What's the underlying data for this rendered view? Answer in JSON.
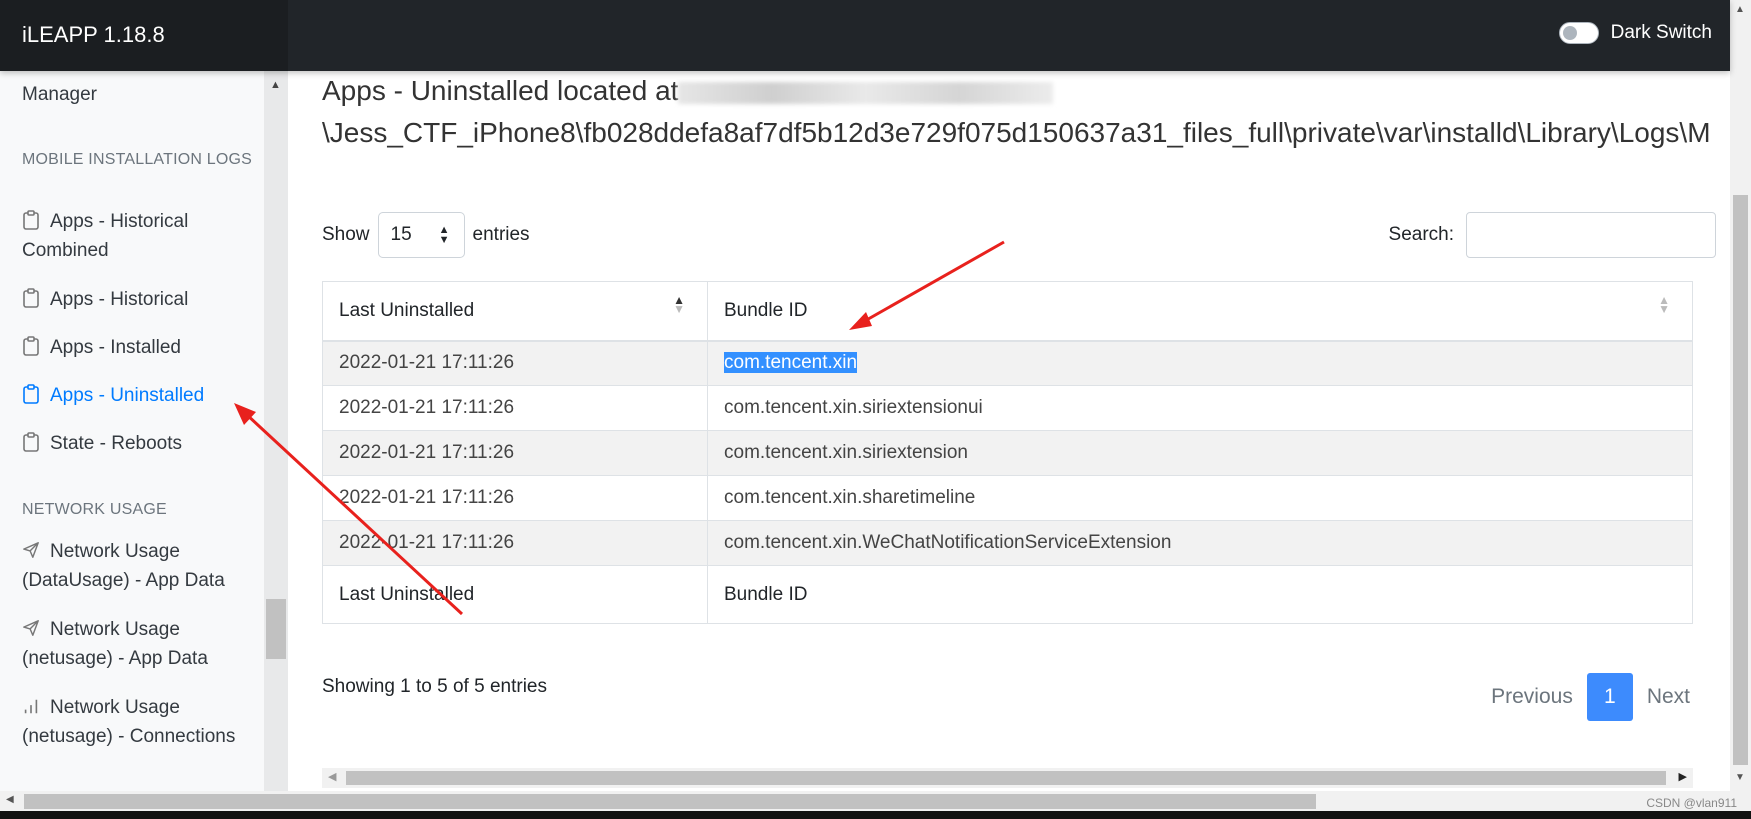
{
  "app": {
    "title": "iLEAPP 1.18.8",
    "dark_switch_label": "Dark Switch"
  },
  "sidebar": {
    "partial_item": "Manager",
    "sections": [
      {
        "heading": "MOBILE INSTALLATION LOGS",
        "items": [
          "Apps - Historical Combined",
          "Apps - Historical",
          "Apps - Installed",
          "Apps - Uninstalled",
          "State - Reboots"
        ]
      },
      {
        "heading": "NETWORK USAGE",
        "items": [
          "Network Usage (DataUsage) - App Data",
          "Network Usage (netusage) - App Data",
          "Network Usage (netusage) - Connections"
        ]
      }
    ],
    "active_item": "Apps - Uninstalled"
  },
  "main": {
    "title_prefix": "Apps - Uninstalled located at",
    "path_line": "\\Jess_CTF_iPhone8\\fb028ddefa8af7df5b12d3e729f075d150637a31_files_full\\private\\var\\installd\\Library\\Logs\\M",
    "show_label": "Show",
    "entries_value": "15",
    "entries_label": "entries",
    "search_label": "Search:",
    "table": {
      "headers": [
        "Last Uninstalled",
        "Bundle ID"
      ],
      "rows": [
        [
          "2022-01-21 17:11:26",
          "com.tencent.xin"
        ],
        [
          "2022-01-21 17:11:26",
          "com.tencent.xin.siriextensionui"
        ],
        [
          "2022-01-21 17:11:26",
          "com.tencent.xin.siriextension"
        ],
        [
          "2022-01-21 17:11:26",
          "com.tencent.xin.sharetimeline"
        ],
        [
          "2022-01-21 17:11:26",
          "com.tencent.xin.WeChatNotificationServiceExtension"
        ]
      ],
      "footers": [
        "Last Uninstalled",
        "Bundle ID"
      ]
    },
    "info": "Showing 1 to 5 of 5 entries",
    "pager": {
      "previous": "Previous",
      "current": "1",
      "next": "Next"
    }
  },
  "watermark": "CSDN @vlan911",
  "colors": {
    "navbar": "#212529",
    "active": "#007bff",
    "selection": "#3390ff",
    "annotation": "#e8211d"
  }
}
